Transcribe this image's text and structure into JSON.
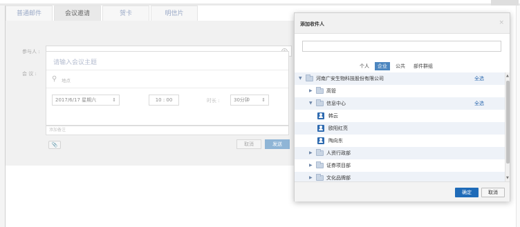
{
  "compose": {
    "tabs": [
      {
        "label": "普通邮件",
        "active": false
      },
      {
        "label": "会议邀请",
        "active": true
      },
      {
        "label": "贺卡",
        "active": false
      },
      {
        "label": "明信片",
        "active": false
      }
    ],
    "attendees_label": "参与人 :",
    "meeting_label": "会   议 :",
    "subject_placeholder": "请输入会议主题",
    "location_placeholder": "地点",
    "date_value": "2017/6/17 星期六",
    "time_value": "10 : 00",
    "duration_label": "时长 :",
    "duration_value": "30分钟",
    "remark_placeholder": "添加备注",
    "cancel_label": "取消",
    "send_label": "发送"
  },
  "dialog": {
    "title": "添加收件人",
    "segments": [
      {
        "label": "个人",
        "active": false
      },
      {
        "label": "企业",
        "active": true
      },
      {
        "label": "公共",
        "active": false
      },
      {
        "label": "部件群组",
        "active": false
      }
    ],
    "select_all_label": "全选",
    "tree": [
      {
        "label": "河南广安生物科技股份有限公司",
        "type": "folder",
        "expanded": true,
        "level": 0,
        "select_all": true
      },
      {
        "label": "高管",
        "type": "folder",
        "expanded": false,
        "level": 1,
        "select_all": false
      },
      {
        "label": "信息中心",
        "type": "folder",
        "expanded": true,
        "level": 1,
        "select_all": true
      },
      {
        "label": "韩云",
        "type": "person",
        "level": 2
      },
      {
        "label": "欧阳红亮",
        "type": "person",
        "level": 2
      },
      {
        "label": "陶向东",
        "type": "person",
        "level": 2
      },
      {
        "label": "人资行政部",
        "type": "folder",
        "expanded": false,
        "level": 1,
        "select_all": false
      },
      {
        "label": "证券项目部",
        "type": "folder",
        "expanded": false,
        "level": 1,
        "select_all": false
      },
      {
        "label": "文化品牌部",
        "type": "folder",
        "expanded": false,
        "level": 1,
        "select_all": false
      }
    ],
    "ok_label": "确定",
    "cancel_label": "取消"
  },
  "colors": {
    "accent": "#1f6bb8",
    "tab_text": "#9aa9c7",
    "send_button": "#8fb5d6"
  },
  "icons": [
    "plus-circle-icon",
    "location-pin-icon",
    "paperclip-icon",
    "close-icon",
    "folder-icon",
    "person-icon",
    "expand-triangle-icon",
    "collapse-triangle-icon",
    "select-arrows-icon"
  ]
}
